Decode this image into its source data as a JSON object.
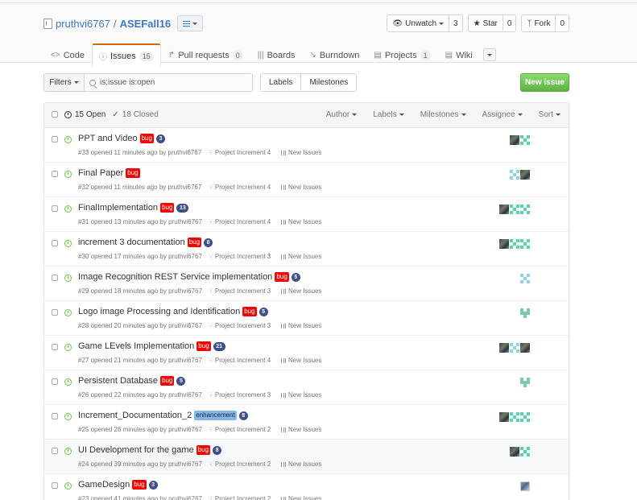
{
  "repo": {
    "owner": "pruthvi6767",
    "separator": "/",
    "name": "ASEFall16"
  },
  "actions": {
    "watch": {
      "label": "Unwatch",
      "count": "3"
    },
    "star": {
      "label": "Star",
      "count": "0"
    },
    "fork": {
      "label": "Fork",
      "count": "0"
    }
  },
  "nav": {
    "code": "Code",
    "issues": "Issues",
    "issues_count": "15",
    "pull_requests": "Pull requests",
    "pull_requests_count": "0",
    "boards": "Boards",
    "burndown": "Burndown",
    "projects": "Projects",
    "projects_count": "1",
    "wiki": "Wiki"
  },
  "subnav": {
    "filters": "Filters",
    "search_value": "is:issue is:open",
    "labels": "Labels",
    "milestones": "Milestones",
    "new_issue": "New issue"
  },
  "header": {
    "open": "15 Open",
    "closed": "18 Closed",
    "author": "Author",
    "labels": "Labels",
    "milestones": "Milestones",
    "assignee": "Assignee",
    "sort": "Sort"
  },
  "colors": {
    "bug_label": "#ee0701",
    "enhancement_label": "#84b6eb",
    "open_icon": "#6cc644",
    "new_issue_button": "#60b044",
    "link": "#4078c0",
    "selected_tab_accent": "#d26911"
  },
  "issues": [
    {
      "title": "PPT and Video",
      "label": "bug",
      "comments": "3",
      "meta": "#33 opened 11 minutes ago by pruthvi6767",
      "milestone": "Project Increment 4",
      "project": "New Issues",
      "avatars": [
        "photo",
        "ident"
      ]
    },
    {
      "title": "Final Paper",
      "label": "bug",
      "comments": "",
      "meta": "#32 opened 11 minutes ago by pruthvi6767",
      "milestone": "Project Increment 4",
      "project": "New Issues",
      "avatars": [
        "ident3",
        "photo"
      ]
    },
    {
      "title": "FinalImplementation",
      "label": "bug",
      "comments": "13",
      "meta": "#31 opened 13 minutes ago by pruthvi6767",
      "milestone": "Project Increment 4",
      "project": "New Issues",
      "avatars": [
        "photo",
        "ident",
        "ident"
      ]
    },
    {
      "title": "increment 3 documentation",
      "label": "bug",
      "comments": "8",
      "meta": "#30 opened 17 minutes ago by pruthvi6767",
      "milestone": "Project Increment 3",
      "project": "New Issues",
      "avatars": [
        "photo",
        "ident",
        "ident"
      ]
    },
    {
      "title": "Image Recognition REST Service implementation",
      "label": "bug",
      "comments": "5",
      "meta": "#29 opened 18 minutes ago by pruthvi6767",
      "milestone": "Project Increment 3",
      "project": "New Issues",
      "avatars": [
        "ident3"
      ]
    },
    {
      "title": "Logo image Processing and Identification",
      "label": "bug",
      "comments": "5",
      "meta": "#28 opened 20 minutes ago by pruthvi6767",
      "milestone": "Project Increment 3",
      "project": "New Issues",
      "avatars": [
        "ident2"
      ]
    },
    {
      "title": "Game LEvels Implementation",
      "label": "bug",
      "comments": "21",
      "meta": "#27 opened 21 minutes ago by pruthvi6767",
      "milestone": "Project Increment 4",
      "project": "New Issues",
      "avatars": [
        "photo",
        "ident3",
        "photo"
      ]
    },
    {
      "title": "Persistent Database",
      "label": "bug",
      "comments": "5",
      "meta": "#26 opened 22 minutes ago by pruthvi6767",
      "milestone": "Project Increment 3",
      "project": "New Issues",
      "avatars": [
        "ident2"
      ]
    },
    {
      "title": "Increment_Documentation_2",
      "label": "enhancement",
      "comments": "8",
      "meta": "#25 opened 26 minutes ago by pruthvi6767",
      "milestone": "Project Increment 2",
      "project": "New Issues",
      "avatars": [
        "photo",
        "ident",
        "ident"
      ]
    },
    {
      "title": "UI Development for the game",
      "label": "bug",
      "comments": "8",
      "meta": "#24 opened 39 minutes ago by pruthvi6767",
      "milestone": "Project Increment 2",
      "project": "New Issues",
      "avatars": [
        "photo",
        "ident"
      ]
    },
    {
      "title": "GameDesign",
      "label": "bug",
      "comments": "3",
      "meta": "#23 opened 41 minutes ago by pruthvi6767",
      "milestone": "Project Increment 2",
      "project": "New Issues",
      "avatars": [
        "photo2"
      ]
    }
  ]
}
